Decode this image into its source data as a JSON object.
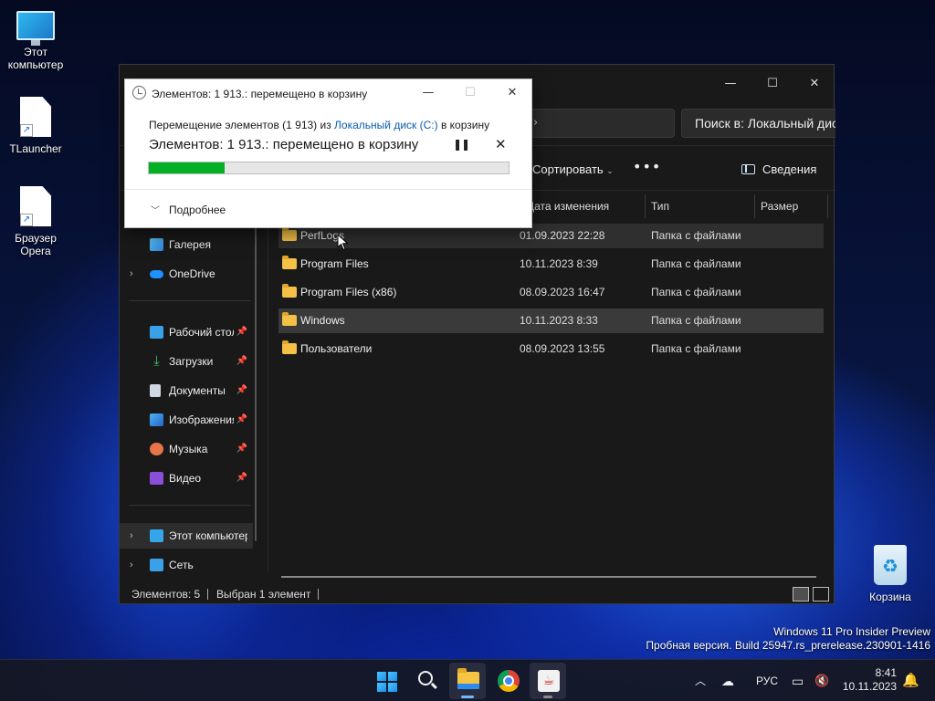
{
  "desktop": {
    "icons": [
      {
        "label": "Этот\nкомпьютер"
      },
      {
        "label": "TLauncher"
      },
      {
        "label": "Браузер\nOpera"
      },
      {
        "label": "Корзина"
      }
    ],
    "watermark": {
      "line1": "Windows 11 Pro Insider Preview",
      "line2": "Пробная версия. Build 25947.rs_prerelease.230901-1416"
    }
  },
  "explorer": {
    "search_placeholder": "Поиск в: Локальный диск (C:)",
    "toolbar": {
      "sort_label": "Сортировать",
      "more_label": "•••",
      "details_label": "Сведения"
    },
    "columns": {
      "date": "Дата изменения",
      "type": "Тип",
      "size": "Размер"
    },
    "rows": [
      {
        "name": "PerfLogs",
        "date": "01.09.2023 22:28",
        "type": "Папка с файлами",
        "state": "hover"
      },
      {
        "name": "Program Files",
        "date": "10.11.2023 8:39",
        "type": "Папка с файлами",
        "state": ""
      },
      {
        "name": "Program Files (x86)",
        "date": "08.09.2023 16:47",
        "type": "Папка с файлами",
        "state": ""
      },
      {
        "name": "Windows",
        "date": "10.11.2023 8:33",
        "type": "Папка с файлами",
        "state": "selected"
      },
      {
        "name": "Пользователи",
        "date": "08.09.2023 13:55",
        "type": "Папка с файлами",
        "state": ""
      }
    ],
    "nav": {
      "gallery": "Галерея",
      "onedrive": "OneDrive",
      "desktop": "Рабочий стол",
      "downloads": "Загрузки",
      "documents": "Документы",
      "pictures": "Изображения",
      "music": "Музыка",
      "video": "Видео",
      "this_pc": "Этот компьютер",
      "network": "Сеть"
    },
    "status": {
      "count": "Элементов: 5",
      "selected": "Выбран 1 элемент"
    }
  },
  "dialog": {
    "title": "Элементов: 1 913.: перемещено в корзину",
    "line1_prefix": "Перемещение элементов (1 913) из ",
    "line1_link": "Локальный диск (C:)",
    "line1_suffix": " в корзину",
    "status": "Элементов: 1 913.: перемещено в корзину",
    "progress": 0.21,
    "more_label": "Подробнее"
  },
  "taskbar": {
    "lang": "РУС",
    "time": "8:41",
    "date": "10.11.2023"
  },
  "colors": {
    "progress_fill": "#06b025",
    "link": "#0b5cad",
    "accent": "#6cb8ff"
  }
}
